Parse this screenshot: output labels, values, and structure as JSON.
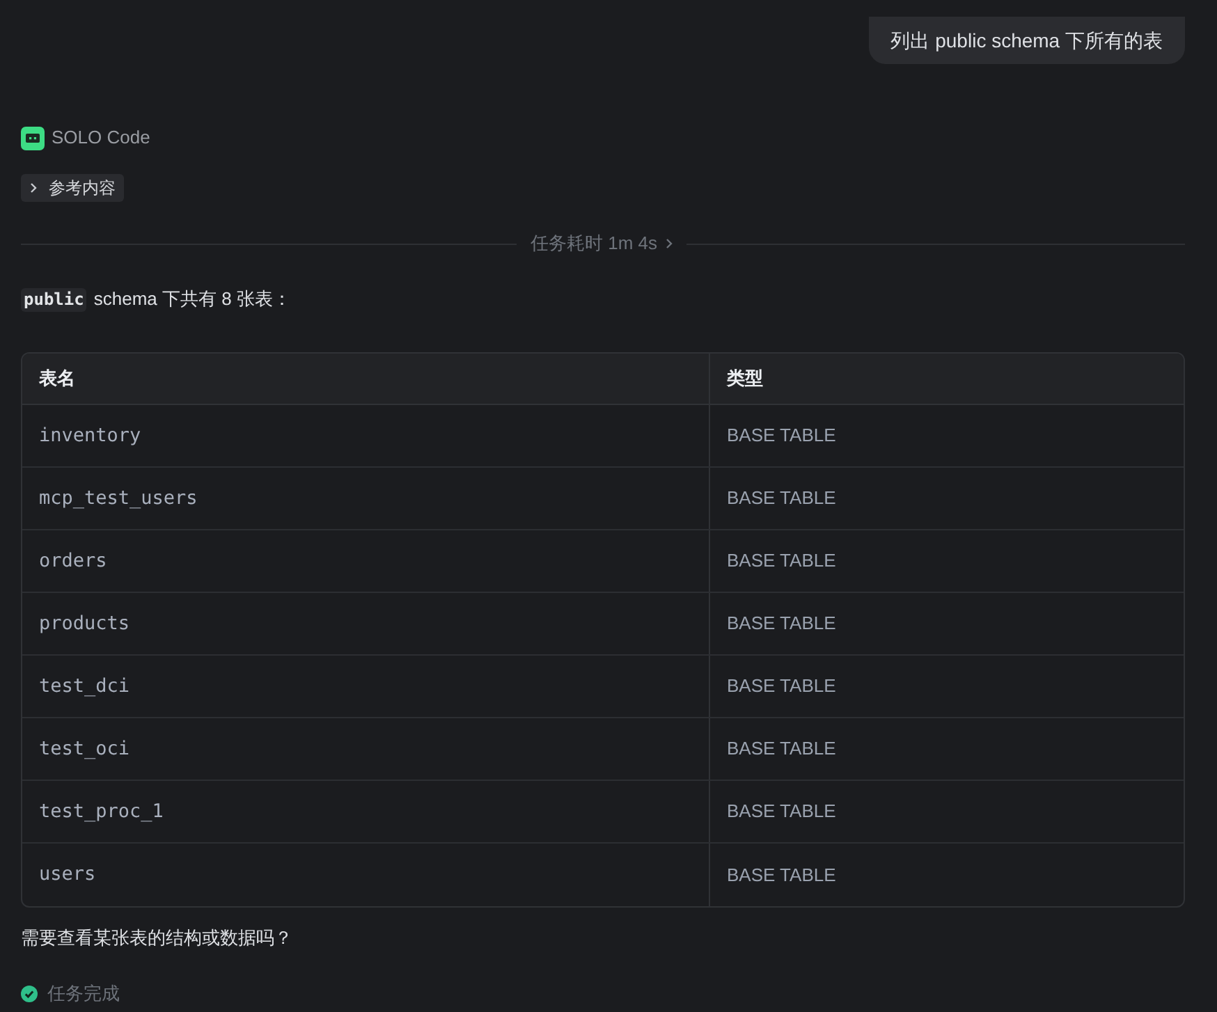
{
  "user_message": {
    "text": "列出 public schema 下所有的表"
  },
  "assistant": {
    "name": "SOLO Code"
  },
  "references": {
    "label": "参考内容",
    "expanded": false
  },
  "task_duration": {
    "label": "任务耗时 1m 4s"
  },
  "summary": {
    "code": "public",
    "text": "schema 下共有 8 张表："
  },
  "table": {
    "columns": [
      "表名",
      "类型"
    ],
    "rows": [
      [
        "inventory",
        "BASE TABLE"
      ],
      [
        "mcp_test_users",
        "BASE TABLE"
      ],
      [
        "orders",
        "BASE TABLE"
      ],
      [
        "products",
        "BASE TABLE"
      ],
      [
        "test_dci",
        "BASE TABLE"
      ],
      [
        "test_oci",
        "BASE TABLE"
      ],
      [
        "test_proc_1",
        "BASE TABLE"
      ],
      [
        "users",
        "BASE TABLE"
      ]
    ]
  },
  "follow_up": "需要查看某张表的结构或数据吗？",
  "status": {
    "kind": "complete",
    "label": "任务完成"
  }
}
